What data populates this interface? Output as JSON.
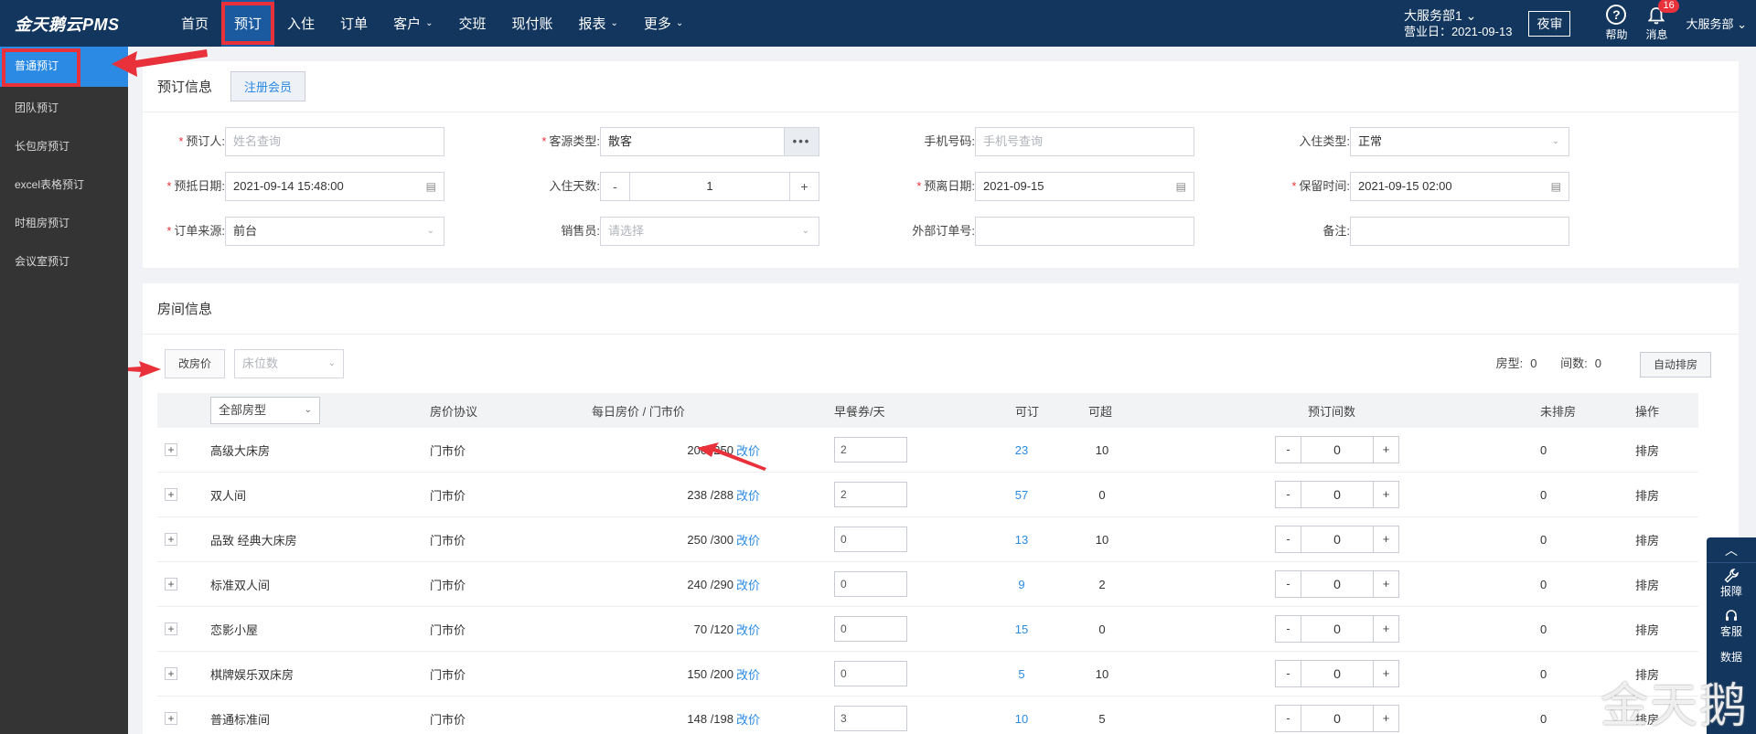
{
  "app": {
    "logo": "金天鹅云PMS"
  },
  "nav": {
    "items": [
      {
        "label": "首页",
        "chev": ""
      },
      {
        "label": "预订",
        "chev": ""
      },
      {
        "label": "入住",
        "chev": ""
      },
      {
        "label": "订单",
        "chev": ""
      },
      {
        "label": "客户",
        "chev": "⌄"
      },
      {
        "label": "交班",
        "chev": ""
      },
      {
        "label": "现付账",
        "chev": ""
      },
      {
        "label": "报表",
        "chev": "⌄"
      },
      {
        "label": "更多",
        "chev": "⌄"
      }
    ]
  },
  "header": {
    "store_name": "大服务部1 ⌄",
    "business_day": "营业日：2021-09-13",
    "night_audit": "夜审",
    "help": "帮助",
    "messages": "消息",
    "message_count": "16",
    "user": "大服务部 ⌄"
  },
  "sidebar": {
    "items": [
      {
        "label": "普通预订"
      },
      {
        "label": "团队预订"
      },
      {
        "label": "长包房预订"
      },
      {
        "label": "excel表格预订"
      },
      {
        "label": "时租房预订"
      },
      {
        "label": "会议室预订"
      }
    ]
  },
  "booking": {
    "title": "预订信息",
    "register_btn": "注册会员",
    "fields": {
      "booker_label": "预订人:",
      "booker_placeholder": "姓名查询",
      "source_type_label": "客源类型:",
      "source_type_value": "散客",
      "phone_label": "手机号码:",
      "phone_placeholder": "手机号查询",
      "checkin_type_label": "入住类型:",
      "checkin_type_value": "正常",
      "arrive_label": "预抵日期:",
      "arrive_value": "2021-09-14 15:48:00",
      "days_label": "入住天数:",
      "days_value": "1",
      "depart_label": "预离日期:",
      "depart_value": "2021-09-15",
      "hold_label": "保留时间:",
      "hold_value": "2021-09-15 02:00",
      "order_source_label": "订单来源:",
      "order_source_value": "前台",
      "sales_label": "销售员:",
      "sales_placeholder": "请选择",
      "ext_order_label": "外部订单号:",
      "ext_order_value": "",
      "remark_label": "备注:",
      "remark_value": ""
    }
  },
  "rooms": {
    "title": "房间信息",
    "change_price_btn": "改房价",
    "bed_select_placeholder": "床位数",
    "room_type_count_label": "房型:",
    "room_type_count": "0",
    "room_count_label": "间数:",
    "room_count": "0",
    "auto_assign_btn": "自动排房",
    "headers": {
      "type_select": "全部房型",
      "agreement": "房价协议",
      "price": "每日房价 / 门市价",
      "breakfast": "早餐券/天",
      "available": "可订",
      "overbook": "可超",
      "qty": "预订间数",
      "unassigned": "未排房",
      "action": "操作"
    },
    "rows": [
      {
        "name": "高级大床房",
        "agreement": "门市价",
        "price": "200 /250",
        "edit": "改价",
        "breakfast": "2",
        "available": "23",
        "overbook": "10",
        "qty": "0",
        "unassigned": "0",
        "action": "排房"
      },
      {
        "name": "双人间",
        "agreement": "门市价",
        "price": "238 /288",
        "edit": "改价",
        "breakfast": "2",
        "available": "57",
        "overbook": "0",
        "qty": "0",
        "unassigned": "0",
        "action": "排房"
      },
      {
        "name": "品致 经典大床房",
        "agreement": "门市价",
        "price": "250 /300",
        "edit": "改价",
        "breakfast": "0",
        "available": "13",
        "overbook": "10",
        "qty": "0",
        "unassigned": "0",
        "action": "排房"
      },
      {
        "name": "标准双人间",
        "agreement": "门市价",
        "price": "240 /290",
        "edit": "改价",
        "breakfast": "0",
        "available": "9",
        "overbook": "2",
        "qty": "0",
        "unassigned": "0",
        "action": "排房"
      },
      {
        "name": "恋影小屋",
        "agreement": "门市价",
        "price": "70 /120",
        "edit": "改价",
        "breakfast": "0",
        "available": "15",
        "overbook": "0",
        "qty": "0",
        "unassigned": "0",
        "action": "排房"
      },
      {
        "name": "棋牌娱乐双床房",
        "agreement": "门市价",
        "price": "150 /200",
        "edit": "改价",
        "breakfast": "0",
        "available": "5",
        "overbook": "10",
        "qty": "0",
        "unassigned": "0",
        "action": "排房"
      },
      {
        "name": "普通标准间",
        "agreement": "门市价",
        "price": "148 /198",
        "edit": "改价",
        "breakfast": "3",
        "available": "10",
        "overbook": "5",
        "qty": "0",
        "unassigned": "0",
        "action": "排房"
      }
    ]
  },
  "float_bar": {
    "report": "报障",
    "service": "客服",
    "data": "数据"
  },
  "watermark": "金天鹅",
  "colors": {
    "nav_bg": "#12365e",
    "accent": "#2a8ae4",
    "highlight": "#e8313a",
    "sidebar_bg": "#343434"
  }
}
